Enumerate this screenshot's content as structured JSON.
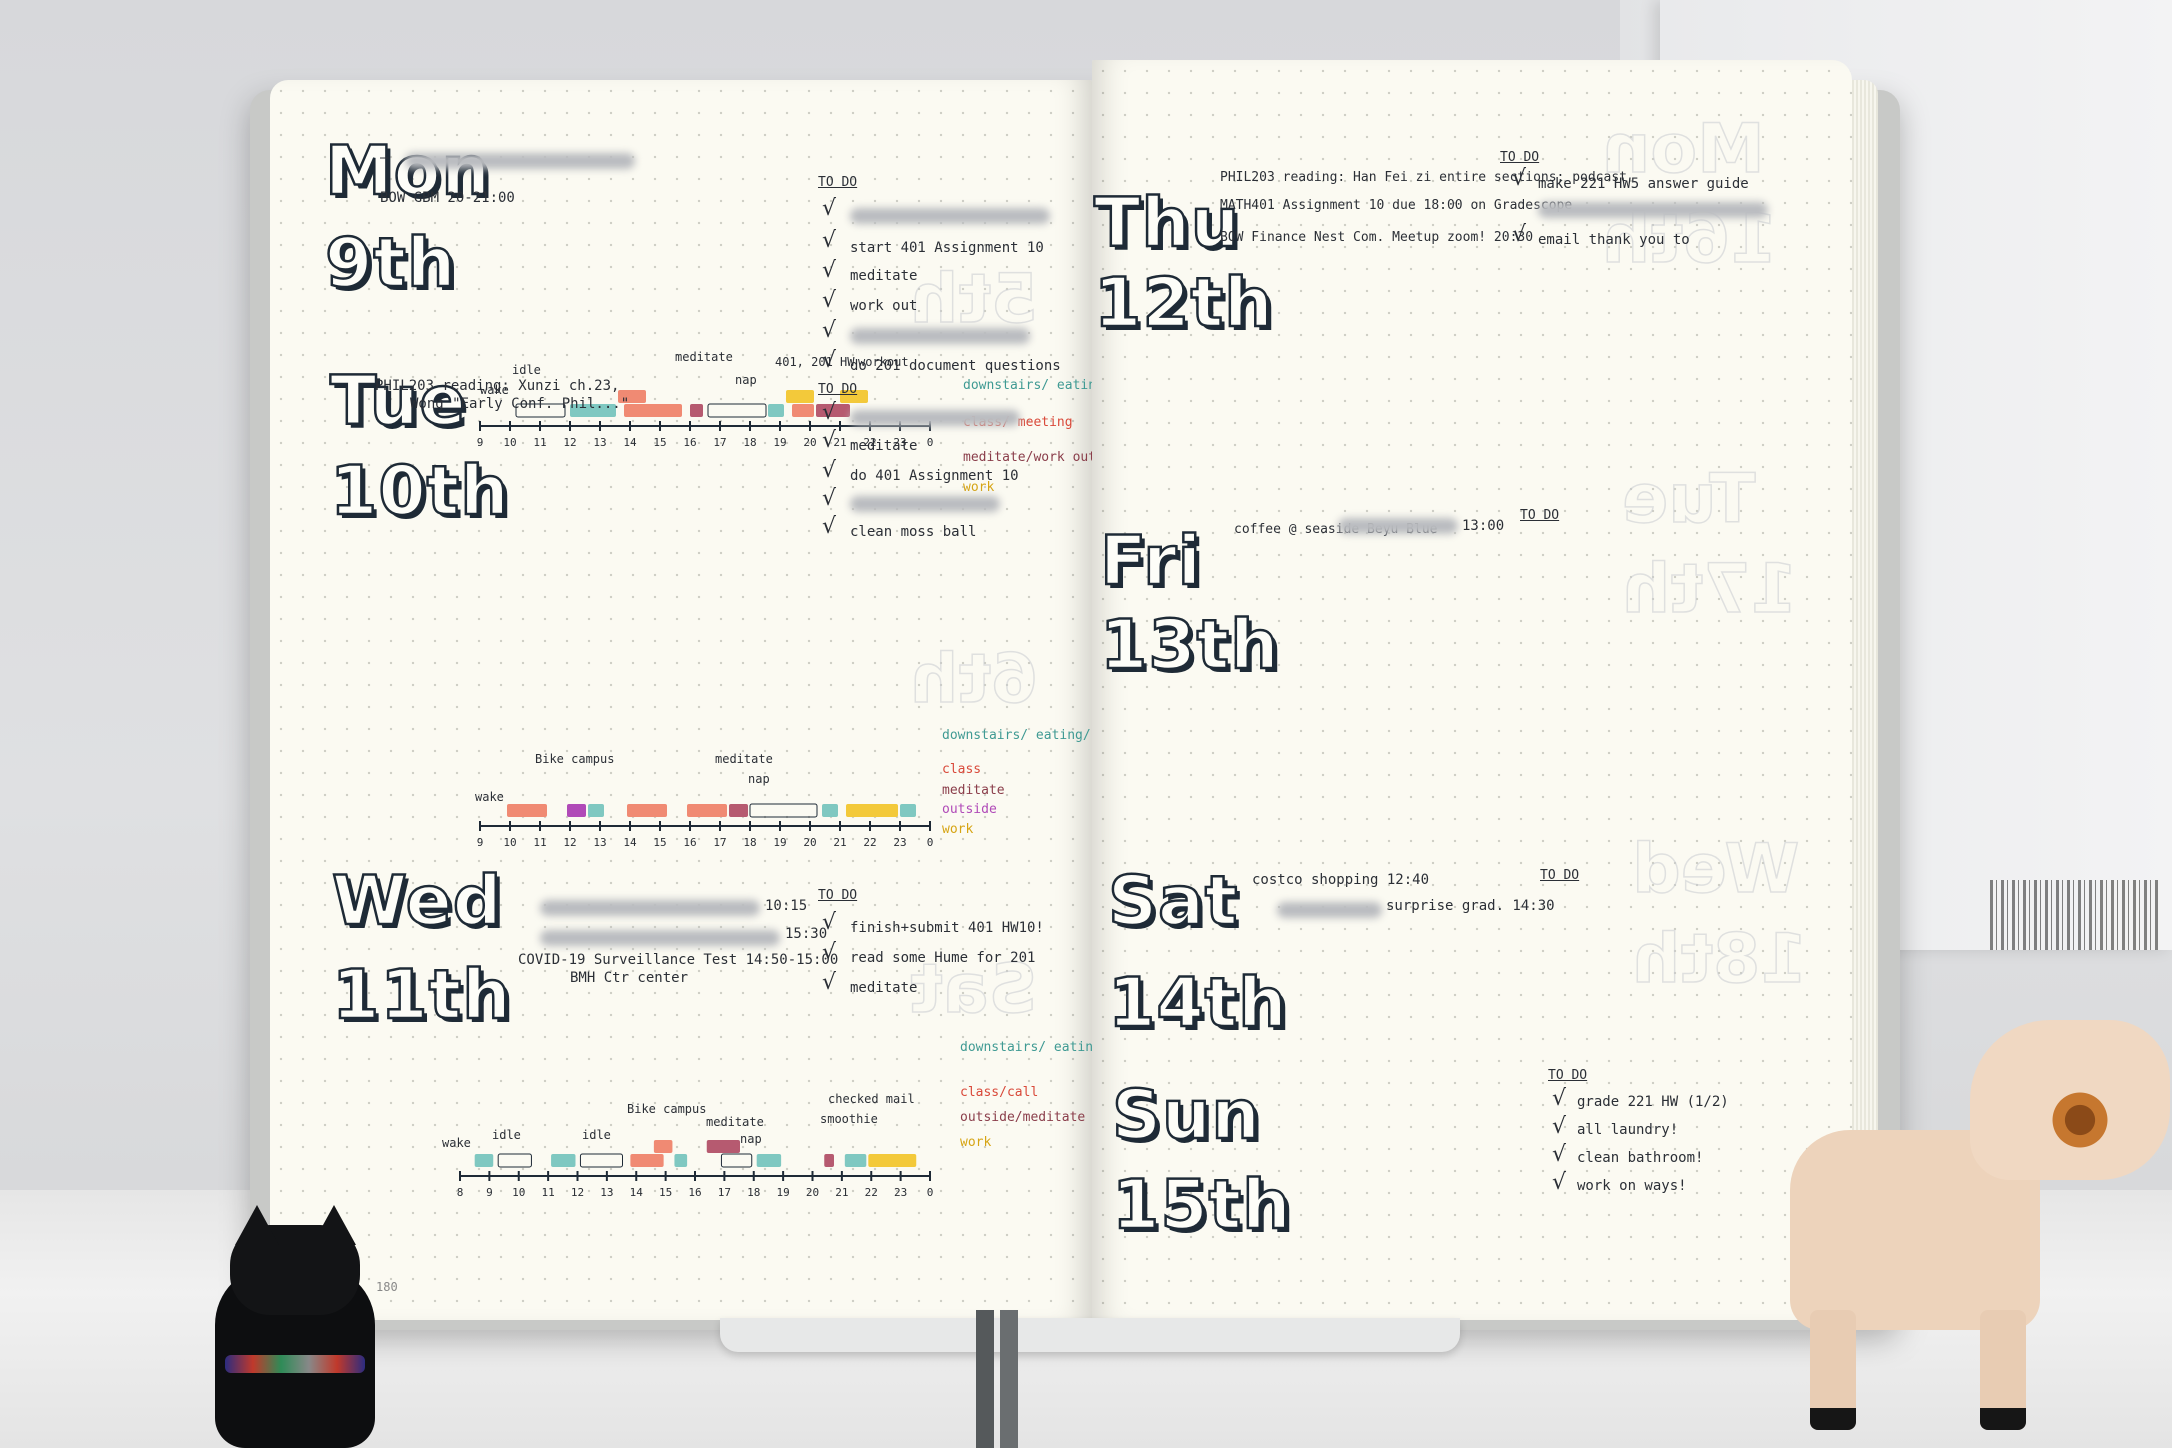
{
  "days": {
    "mon": {
      "name": "Mon",
      "date": "9th"
    },
    "tue": {
      "name": "Tue",
      "date": "10th"
    },
    "wed": {
      "name": "Wed",
      "date": "11th"
    },
    "thu": {
      "name": "Thu",
      "date": "12th"
    },
    "fri": {
      "name": "Fri",
      "date": "13th"
    },
    "sat": {
      "name": "Sat",
      "date": "14th"
    },
    "sun": {
      "name": "Sun",
      "date": "15th"
    }
  },
  "todo_label": "TO DO",
  "mon": {
    "events": [
      "BOW GBM 20-21:00"
    ],
    "todos": [
      "start 401 Assignment 10",
      "meditate",
      "work out",
      "do 201 document questions"
    ],
    "annotations": [
      "wake",
      "idle",
      "meditate",
      "nap",
      "401, 201 HW",
      "workout"
    ],
    "ticks": [
      "9",
      "10",
      "11",
      "12",
      "13",
      "14",
      "15",
      "16",
      "17",
      "18",
      "19",
      "20",
      "21",
      "22",
      "23",
      "0"
    ],
    "legend": [
      "downstairs/ eating/shower",
      "class/ meeting",
      "meditate/work out/ hobbies",
      "work"
    ]
  },
  "tue": {
    "events": [
      "PHIL203 reading: Xunzi ch.23,",
      "Wong \"Early Conf. Phil...\""
    ],
    "todos": [
      "meditate",
      "do 401 Assignment 10",
      "clean moss ball"
    ],
    "annotations": [
      "wake",
      "Bike campus",
      "meditate",
      "nap"
    ],
    "ticks": [
      "9",
      "10",
      "11",
      "12",
      "13",
      "14",
      "15",
      "16",
      "17",
      "18",
      "19",
      "20",
      "21",
      "22",
      "23",
      "0"
    ],
    "legend": [
      "downstairs/ eating/shower",
      "class",
      "meditate",
      "outside",
      "work"
    ]
  },
  "wed": {
    "events": [
      "10:15",
      "15:30",
      "COVID-19 Surveillance Test 14:50-15:00",
      "BMH Ctr center"
    ],
    "todos": [
      "finish+submit 401 HW10!",
      "read some Hume for 201",
      "meditate"
    ],
    "annotations": [
      "wake",
      "idle",
      "idle",
      "Bike campus",
      "meditate",
      "nap",
      "checked mail",
      "smoothie"
    ],
    "ticks": [
      "8",
      "9",
      "10",
      "11",
      "12",
      "13",
      "14",
      "15",
      "16",
      "17",
      "18",
      "19",
      "20",
      "21",
      "22",
      "23",
      "0"
    ],
    "legend": [
      "downstairs/ eating/shower",
      "class/call",
      "outside/meditate",
      "work"
    ]
  },
  "thu": {
    "events": [
      "PHIL203 reading: Han Fei zi entire sections; podcast",
      "MATH401 Assignment 10 due 18:00 on Gradescope",
      "BOW Finance Nest Com. Meetup zoom! 20:30"
    ],
    "todos": [
      "make 221 HW5 answer guide",
      "email thank you to"
    ]
  },
  "fri": {
    "events": [
      "coffee @ seaside Beyu Blue",
      "13:00"
    ]
  },
  "sat": {
    "events": [
      "costco shopping 12:40",
      "surprise grad. 14:30"
    ]
  },
  "sun": {
    "todos": [
      "grade 221 HW (1/2)",
      "all laundry!",
      "clean bathroom!",
      "work on ways!"
    ]
  },
  "page_number": "180",
  "colors": {
    "downstairs": "#7fc8c1",
    "class": "#f08a73",
    "meditate": "#b65a70",
    "outside": "#b04ab8",
    "work": "#f3c93a",
    "ink": "#1e2a36",
    "paper": "#fbfaf2"
  }
}
